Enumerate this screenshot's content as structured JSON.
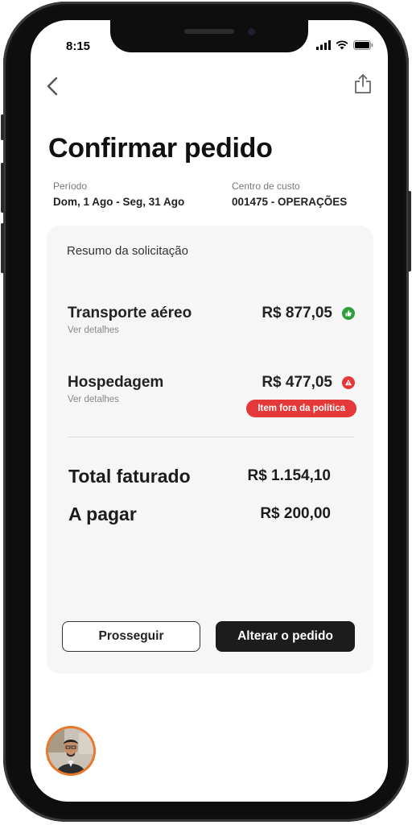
{
  "status_bar": {
    "time": "8:15"
  },
  "nav": {
    "back_icon": "chevron-left-icon",
    "share_icon": "share-icon"
  },
  "page": {
    "title": "Confirmar pedido"
  },
  "meta": {
    "period_label": "Período",
    "period_value": "Dom, 1 Ago - Seg, 31 Ago",
    "cost_center_label": "Centro de custo",
    "cost_center_value": "001475 - OPERAÇÕES"
  },
  "summary": {
    "heading": "Resumo da solicitação",
    "items": [
      {
        "name": "Transporte aéreo",
        "details_link": "Ver detalhes",
        "price": "R$ 877,05",
        "status": "ok",
        "status_color": "#2e9e3e"
      },
      {
        "name": "Hospedagem",
        "details_link": "Ver detalhes",
        "price": "R$ 477,05",
        "status": "warning",
        "status_color": "#e53939",
        "badge": "Item fora da política"
      }
    ],
    "totals": [
      {
        "label": "Total faturado",
        "value": "R$ 1.154,10"
      },
      {
        "label": "A pagar",
        "value": "R$ 200,00"
      }
    ]
  },
  "actions": {
    "proceed": "Prosseguir",
    "change": "Alterar o pedido"
  },
  "colors": {
    "accent_dark": "#1c1c1c",
    "danger": "#e53939",
    "success": "#2e9e3e",
    "avatar_ring": "#e9772c"
  }
}
